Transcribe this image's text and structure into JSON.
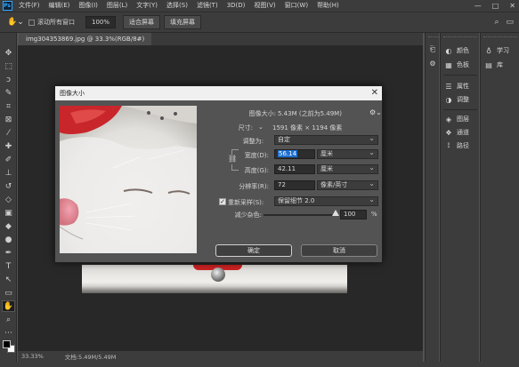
{
  "menu": {
    "logo": "Ps",
    "items": [
      "文件(F)",
      "编辑(E)",
      "图像(I)",
      "图层(L)",
      "文字(Y)",
      "选择(S)",
      "滤镜(T)",
      "3D(D)",
      "视图(V)",
      "窗口(W)",
      "帮助(H)"
    ],
    "window_controls": [
      "—",
      "□",
      "✕"
    ]
  },
  "options": {
    "scroll_all_label": "滚动所有窗口",
    "zoom_value": "100%",
    "fit_screen_label": "适合屏幕",
    "fill_screen_label": "填充屏幕"
  },
  "document_tab": "img304353869.jpg @ 33.3%(RGB/8#)",
  "status": {
    "zoom": "33.33%",
    "doc_info": "文档:5.49M/5.49M"
  },
  "panels": {
    "col2": [
      "颜色",
      "色板",
      "属性",
      "调整",
      "图层",
      "通道",
      "路径"
    ],
    "col3": [
      "学习",
      "库"
    ]
  },
  "dialog": {
    "title": "图像大小",
    "close": "✕",
    "image_size_label": "图像大小:",
    "image_size_value": "5.43M (之前为5.49M)",
    "dimensions_label": "尺寸:",
    "dimensions_value": "1591 像素 × 1194 像素",
    "fit_to_label": "调整为:",
    "fit_to_value": "自定",
    "width_label": "宽度(D):",
    "width_value": "56.14",
    "width_unit": "厘米",
    "height_label": "高度(G):",
    "height_value": "42.11",
    "height_unit": "厘米",
    "resolution_label": "分辨率(R):",
    "resolution_value": "72",
    "resolution_unit": "像素/英寸",
    "resample_label": "重新采样(S):",
    "resample_value": "保留细节 2.0",
    "reduce_noise_label": "减少杂色:",
    "reduce_noise_value": "100",
    "reduce_noise_unit": "%",
    "ok_label": "确定",
    "cancel_label": "取消"
  }
}
